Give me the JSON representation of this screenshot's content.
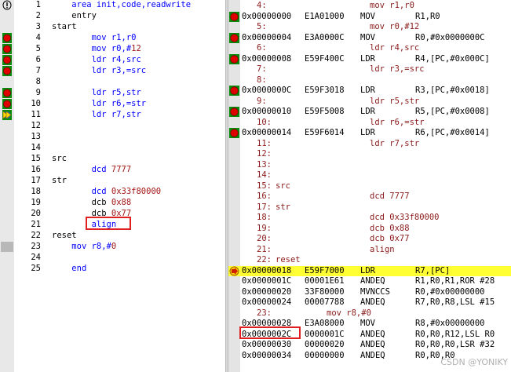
{
  "left_lines": [
    {
      "n": "1",
      "indent": "    ",
      "parts": [
        {
          "t": "area init,code,readwrite",
          "c": "kw"
        }
      ],
      "mark": "debug"
    },
    {
      "n": "2",
      "indent": "    ",
      "parts": [
        {
          "t": "entry",
          "c": ""
        }
      ],
      "mark": ""
    },
    {
      "n": "3",
      "indent": "",
      "parts": [
        {
          "t": "start",
          "c": ""
        }
      ],
      "mark": ""
    },
    {
      "n": "4",
      "indent": "        ",
      "parts": [
        {
          "t": "mov r1,r0",
          "c": "kw"
        }
      ],
      "mark": "bp"
    },
    {
      "n": "5",
      "indent": "        ",
      "parts": [
        {
          "t": "mov r0,#",
          "c": "kw"
        },
        {
          "t": "12",
          "c": "num"
        }
      ],
      "mark": "bp"
    },
    {
      "n": "6",
      "indent": "        ",
      "parts": [
        {
          "t": "ldr r4,src",
          "c": "kw"
        }
      ],
      "mark": "bp"
    },
    {
      "n": "7",
      "indent": "        ",
      "parts": [
        {
          "t": "ldr r3,=src",
          "c": "kw"
        }
      ],
      "mark": "bp"
    },
    {
      "n": "8",
      "indent": "",
      "parts": [],
      "mark": ""
    },
    {
      "n": "9",
      "indent": "        ",
      "parts": [
        {
          "t": "ldr r5,str",
          "c": "kw"
        }
      ],
      "mark": "bp"
    },
    {
      "n": "10",
      "indent": "        ",
      "parts": [
        {
          "t": "ldr r6,=str",
          "c": "kw"
        }
      ],
      "mark": "bp"
    },
    {
      "n": "11",
      "indent": "        ",
      "parts": [
        {
          "t": "ldr r7,str",
          "c": "kw"
        }
      ],
      "mark": "arrow"
    },
    {
      "n": "12",
      "indent": "",
      "parts": [],
      "mark": ""
    },
    {
      "n": "13",
      "indent": "",
      "parts": [],
      "mark": ""
    },
    {
      "n": "14",
      "indent": "",
      "parts": [],
      "mark": ""
    },
    {
      "n": "15",
      "indent": "",
      "parts": [
        {
          "t": "src",
          "c": ""
        }
      ],
      "mark": ""
    },
    {
      "n": "16",
      "indent": "        ",
      "parts": [
        {
          "t": "dcd ",
          "c": "kw"
        },
        {
          "t": "7777",
          "c": "num"
        }
      ],
      "mark": ""
    },
    {
      "n": "17",
      "indent": "",
      "parts": [
        {
          "t": "str",
          "c": ""
        }
      ],
      "mark": ""
    },
    {
      "n": "18",
      "indent": "        ",
      "parts": [
        {
          "t": "dcd ",
          "c": "kw"
        },
        {
          "t": "0x33f80000",
          "c": "num"
        }
      ],
      "mark": ""
    },
    {
      "n": "19",
      "indent": "        ",
      "parts": [
        {
          "t": "dcb ",
          "c": ""
        },
        {
          "t": "0x88",
          "c": "num"
        }
      ],
      "mark": ""
    },
    {
      "n": "20",
      "indent": "        ",
      "parts": [
        {
          "t": "dcb ",
          "c": ""
        },
        {
          "t": "0x77",
          "c": "num"
        }
      ],
      "mark": ""
    },
    {
      "n": "21",
      "indent": "        ",
      "parts": [
        {
          "t": "align",
          "c": "kw"
        }
      ],
      "mark": ""
    },
    {
      "n": "22",
      "indent": "",
      "parts": [
        {
          "t": "reset",
          "c": ""
        }
      ],
      "mark": ""
    },
    {
      "n": "23",
      "indent": "    ",
      "parts": [
        {
          "t": "mov r8,#",
          "c": "kw"
        },
        {
          "t": "0",
          "c": "num"
        }
      ],
      "mark": "grey"
    },
    {
      "n": "24",
      "indent": "",
      "parts": [],
      "mark": ""
    },
    {
      "n": "25",
      "indent": "    ",
      "parts": [
        {
          "t": "end",
          "c": "kw"
        }
      ],
      "mark": ""
    }
  ],
  "right_lines": [
    {
      "type": "src",
      "num": "4:",
      "text": "mov r1,r0",
      "indent": 150
    },
    {
      "type": "asm",
      "addr": "0x00000000",
      "op": "E1A01000",
      "mn": "MOV",
      "args": "R1,R0",
      "bp": true
    },
    {
      "type": "src",
      "num": "5:",
      "text": "mov r0,#12",
      "indent": 150
    },
    {
      "type": "asm",
      "addr": "0x00000004",
      "op": "E3A0000C",
      "mn": "MOV",
      "args": "R0,#0x0000000C",
      "bp": true
    },
    {
      "type": "src",
      "num": "6:",
      "text": "ldr r4,src",
      "indent": 150
    },
    {
      "type": "asm",
      "addr": "0x00000008",
      "op": "E59F400C",
      "mn": "LDR",
      "args": "R4,[PC,#0x000C]",
      "bp": true
    },
    {
      "type": "src",
      "num": "7:",
      "text": "ldr r3,=src",
      "indent": 150
    },
    {
      "type": "src",
      "num": "8:",
      "text": "",
      "indent": 150
    },
    {
      "type": "asm",
      "addr": "0x0000000C",
      "op": "E59F3018",
      "mn": "LDR",
      "args": "R3,[PC,#0x0018]",
      "bp": true
    },
    {
      "type": "src",
      "num": "9:",
      "text": "ldr r5,str",
      "indent": 150
    },
    {
      "type": "asm",
      "addr": "0x00000010",
      "op": "E59F5008",
      "mn": "LDR",
      "args": "R5,[PC,#0x0008]",
      "bp": true
    },
    {
      "type": "src",
      "num": "10:",
      "text": "ldr r6,=str",
      "indent": 150
    },
    {
      "type": "asm",
      "addr": "0x00000014",
      "op": "E59F6014",
      "mn": "LDR",
      "args": "R6,[PC,#0x0014]",
      "bp": true
    },
    {
      "type": "src",
      "num": "11:",
      "text": "ldr r7,str",
      "indent": 150
    },
    {
      "type": "src",
      "num": "12:",
      "text": "",
      "indent": 150
    },
    {
      "type": "src",
      "num": "13:",
      "text": "",
      "indent": 150
    },
    {
      "type": "src",
      "num": "14:",
      "text": "",
      "indent": 150
    },
    {
      "type": "src",
      "num": "15:",
      "text": "src",
      "indent": 55
    },
    {
      "type": "src",
      "num": "16:",
      "text": "dcd 7777",
      "indent": 150
    },
    {
      "type": "src",
      "num": "17:",
      "text": "str",
      "indent": 55
    },
    {
      "type": "src",
      "num": "18:",
      "text": "dcd 0x33f80000",
      "indent": 150
    },
    {
      "type": "src",
      "num": "19:",
      "text": "dcb 0x88",
      "indent": 150
    },
    {
      "type": "src",
      "num": "20:",
      "text": "dcb 0x77",
      "indent": 150
    },
    {
      "type": "src",
      "num": "21:",
      "text": "align",
      "indent": 150
    },
    {
      "type": "src",
      "num": "22:",
      "text": "reset",
      "indent": 55
    },
    {
      "type": "asm",
      "addr": "0x00000018",
      "op": "E59F7000",
      "mn": "LDR",
      "args": "R7,[PC]",
      "pc": true
    },
    {
      "type": "asm",
      "addr": "0x0000001C",
      "op": "00001E61",
      "mn": "ANDEQ",
      "args": "R1,R0,R1,ROR #28"
    },
    {
      "type": "asm",
      "addr": "0x00000020",
      "op": "33F80000",
      "mn": "MVNCCS",
      "args": "R0,#0x00000000"
    },
    {
      "type": "asm",
      "addr": "0x00000024",
      "op": "00007788",
      "mn": "ANDEQ",
      "args": "R7,R0,R8,LSL #15"
    },
    {
      "type": "src",
      "num": "23:",
      "text": "mov r8,#0",
      "indent": 110
    },
    {
      "type": "asm",
      "addr": "0x00000028",
      "op": "E3A08000",
      "mn": "MOV",
      "args": "R8,#0x00000000"
    },
    {
      "type": "asm",
      "addr": "0x0000002C",
      "op": "0000001C",
      "mn": "ANDEQ",
      "args": "R0,R0,R12,LSL R0"
    },
    {
      "type": "asm",
      "addr": "0x00000030",
      "op": "00000020",
      "mn": "ANDEQ",
      "args": "R0,R0,R0,LSR #32"
    },
    {
      "type": "asm",
      "addr": "0x00000034",
      "op": "00000000",
      "mn": "ANDEQ",
      "args": "R0,R0,R0"
    }
  ],
  "watermark": "CSDN @YONIKY",
  "colors": {
    "keyword": "#0000ff",
    "number": "#a31515",
    "disasm_source": "#8b1a1a",
    "pc_highlight": "#ffff33",
    "breakpoint": "#e00000",
    "annotation_box": "#e02020"
  }
}
